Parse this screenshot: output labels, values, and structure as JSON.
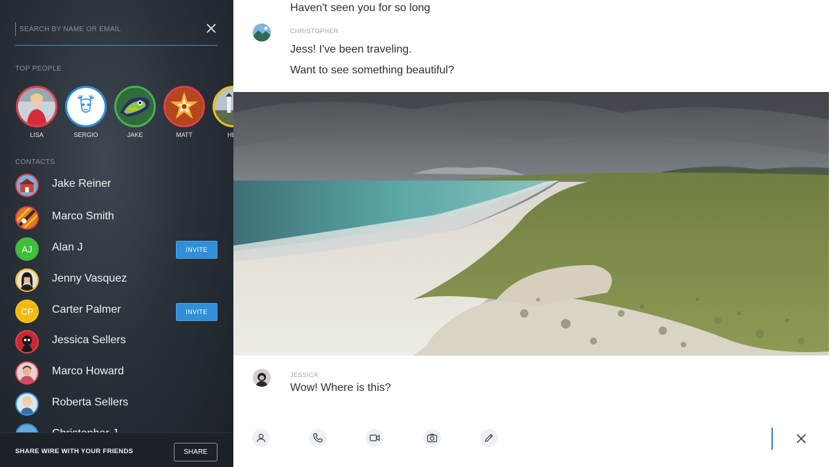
{
  "sidebar": {
    "search": {
      "placeholder": "SEARCH BY NAME OR EMAIL",
      "value": ""
    },
    "top_people_label": "TOP PEOPLE",
    "top_people": [
      {
        "name": "LISA",
        "ring_color": "#e0404a"
      },
      {
        "name": "SERGIO",
        "ring_color": "#2f8fd8"
      },
      {
        "name": "JAKE",
        "ring_color": "#4caf50"
      },
      {
        "name": "MATT",
        "ring_color": "#e0404a"
      },
      {
        "name": "HEL",
        "ring_color": "#f2c318"
      }
    ],
    "contacts_label": "CONTACTS",
    "contacts": [
      {
        "name": "Jake Reiner",
        "ring_color": "#e0404a",
        "invite": false,
        "initials": ""
      },
      {
        "name": "Marco Smith",
        "ring_color": "#e0404a",
        "invite": false,
        "initials": ""
      },
      {
        "name": "Alan J",
        "ring_color": "#4caf50",
        "invite": true,
        "initials": "AJ"
      },
      {
        "name": "Jenny Vasquez",
        "ring_color": "#f2c318",
        "invite": false,
        "initials": ""
      },
      {
        "name": "Carter Palmer",
        "ring_color": "#f2c318",
        "invite": true,
        "initials": "CP"
      },
      {
        "name": "Jessica Sellers",
        "ring_color": "#e0404a",
        "invite": false,
        "initials": ""
      },
      {
        "name": "Marco Howard",
        "ring_color": "#e0404a",
        "invite": false,
        "initials": ""
      },
      {
        "name": "Roberta Sellers",
        "ring_color": "#2f8fd8",
        "invite": false,
        "initials": ""
      },
      {
        "name": "Christopher J",
        "ring_color": "#2f8fd8",
        "invite": false,
        "initials": ""
      }
    ],
    "invite_label": "INVITE",
    "share_text": "SHARE WIRE WITH YOUR FRIENDS",
    "share_button": "SHARE"
  },
  "conversation": {
    "messages": [
      {
        "author": "",
        "lines": [
          "Haven't seen you for so long"
        ]
      },
      {
        "author": "CHRISTOPHER",
        "lines": [
          "Jess! I've been traveling.",
          "Want to see something beautiful?"
        ]
      },
      {
        "author": "",
        "image": "beach-photo"
      },
      {
        "author": "JESSICA",
        "lines": [
          "Wow! Where is this?"
        ]
      }
    ],
    "toolbar": [
      "person-icon",
      "phone-icon",
      "video-icon",
      "camera-icon",
      "pencil-icon",
      "close-icon"
    ]
  },
  "colors": {
    "accent": "#2f8fd8",
    "sidebar_bg": "#2a3139",
    "text_dark": "#2a2f35",
    "muted": "#8a949e"
  }
}
